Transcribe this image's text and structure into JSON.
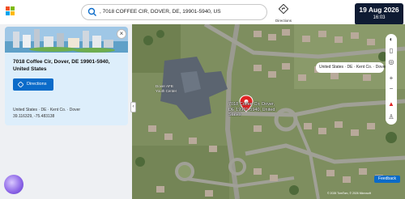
{
  "search": {
    "value": ", 7018 COFFEE CIR, DOVER, DE, 19901-5940, US"
  },
  "toolbar": {
    "directions_label": "Directions"
  },
  "clock": {
    "date": "19 Aug 2026",
    "time": "16:03"
  },
  "place": {
    "title": "7018 Coffee Cir, Dover, DE 19901-5940, United States",
    "directions_button": "Directions",
    "region": "United States · DE · Kent Co. · Dover",
    "coordinates": "39.116329, -75.483138"
  },
  "map": {
    "pin_label": "7018 Coffee Cir, Dover, DE 19901-5940, United States",
    "building_label": "Dover AFB Youth Center",
    "breadcrumb": "United States · DE · Kent Co. · Dover",
    "feedback": "Feedback",
    "copyright": "© 2026 TomTom, © 2026 Microsoft"
  },
  "colors": {
    "accent": "#0b6bc9",
    "pin": "#e02424",
    "clock_bg": "#0f1b33"
  }
}
